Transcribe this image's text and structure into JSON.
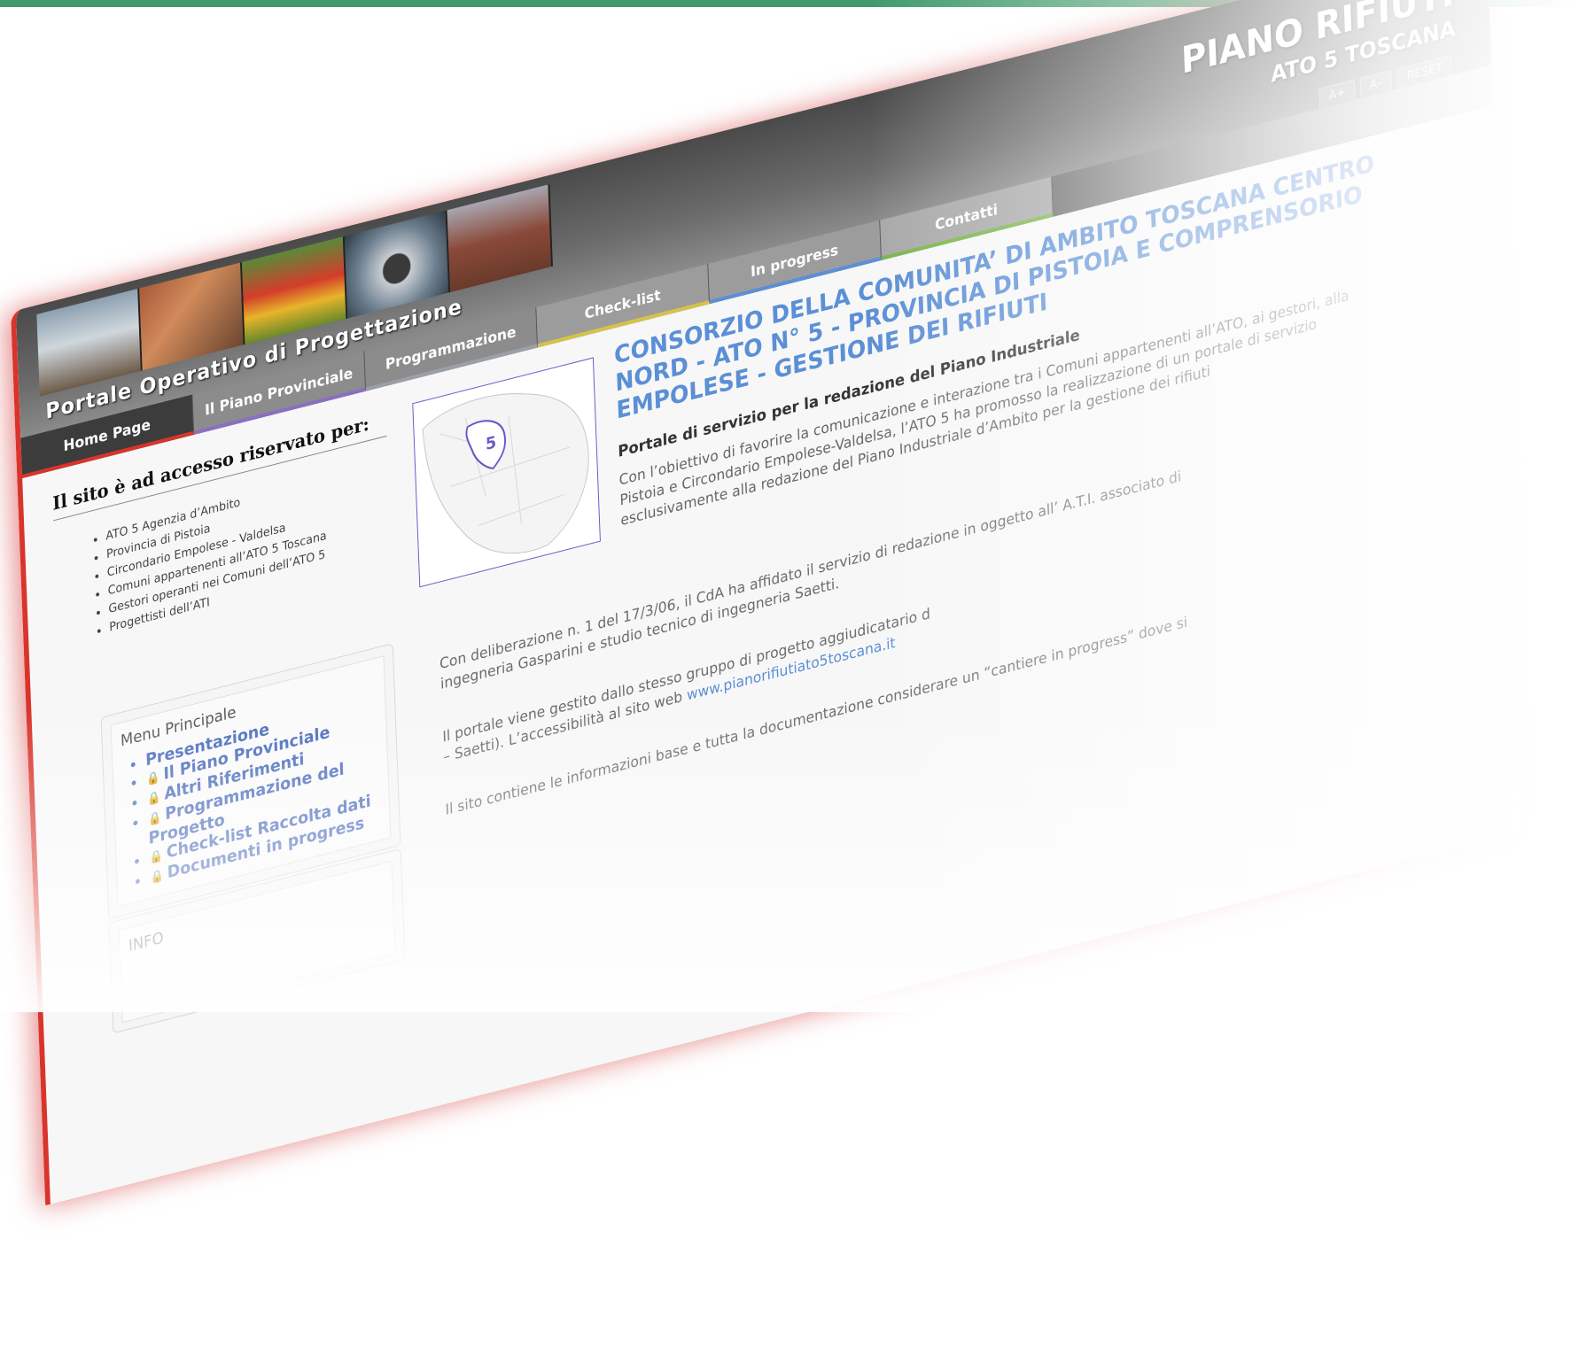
{
  "header": {
    "portal_title": "Portale Operativo di Progettazione",
    "brand_line1": "PIANO RIFIUTI",
    "brand_line2": "ATO 5 TOSCANA",
    "font_buttons": [
      "A+",
      "A–",
      "RESET"
    ],
    "site_url": "www.pianorifiutiato5toscana.it"
  },
  "nav": {
    "tabs": [
      "Home Page",
      "Il Piano Provinciale",
      "Programmazione",
      "Check-list",
      "In progress",
      "Contatti"
    ]
  },
  "left": {
    "access_title": "Il sito è ad accesso riservato per:",
    "access_items": [
      "ATO 5 Agenzia d’Ambito",
      "Provincia di Pistoia",
      "Circondario Empolese - Valdelsa",
      "Comuni appartenenti all’ATO 5 Toscana",
      "Gestori operanti nei Comuni dell’ATO 5",
      "Progettisti dell’ATI"
    ],
    "menu_title": "Menu Principale",
    "menu_items": [
      "Presentazione",
      "Il Piano Provinciale",
      "Altri Riferimenti",
      "Programmazione del Progetto",
      "Check-list Raccolta dati",
      "Documenti in progress"
    ],
    "info_title": "INFO"
  },
  "main": {
    "map_badge": "5",
    "headline": "CONSORZIO DELLA COMUNITA’ DI AMBITO TOSCANA CENTRO NORD - ATO N° 5 - PROVINCIA DI PISTOIA E COMPRENSORIO EMPOLESE - GESTIONE DEI RIFIUTI",
    "subhead": "Portale di servizio per la redazione del Piano Industriale",
    "intro": "Con l’obiettivo di favorire la comunicazione e interazione tra i Comuni appartenenti all’ATO, ai gestori, alla Pistoia e Circondario Empolese-Valdelsa, l’ATO 5 ha promosso la realizzazione di un portale di servizio esclusivamente alla redazione del Piano Industriale d’Ambito per la gestione dei rifiuti",
    "para1": "Con deliberazione n. 1 del 17/3/06, il CdA ha affidato il servizio di redazione in oggetto all’ A.T.I. associato di ingegneria Gasparini e studio tecnico di ingegneria Saetti.",
    "para2_a": "Il portale viene gestito dallo stesso gruppo di progetto aggiudicatario d",
    "para2_b": "– Saetti). L’accessibilità al sito web",
    "para2_link": "www.pianorifiutiato5toscana.it",
    "para3": "Il sito contiene le informazioni base e tutta la documentazione considerare un “cantiere in progress” dove si"
  }
}
